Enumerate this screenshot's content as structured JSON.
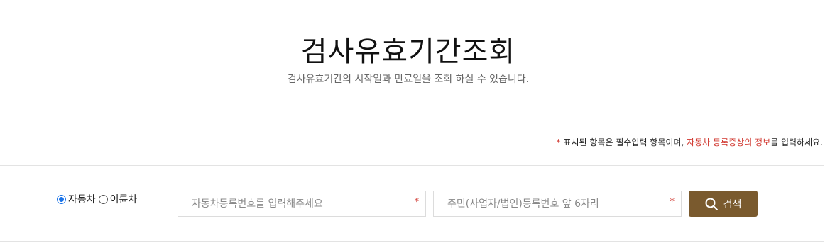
{
  "page": {
    "title": "검사유효기간조회",
    "subtitle": "검사유효기간의 시작일과 만료일을 조회 하실 수 있습니다."
  },
  "notice": {
    "asterisk": "*",
    "text_before": " 표시된 항목은 필수입력 항목이며, ",
    "highlight": "자동차 등록증상의 정보",
    "text_after": "를 입력하세요."
  },
  "vehicle_type": {
    "options": [
      {
        "label": "자동차",
        "checked": true
      },
      {
        "label": "이륜차",
        "checked": false
      }
    ]
  },
  "form": {
    "reg_number": {
      "value": "",
      "placeholder": "자동차등록번호를 입력해주세요",
      "required_mark": "*"
    },
    "id_number": {
      "value": "",
      "placeholder": "주민(사업자/법인)등록번호 앞 6자리",
      "required_mark": "*"
    },
    "search_label": "검색",
    "search_icon": "search-icon",
    "accent_color": "#7a5a2e",
    "required_color": "#d0342c"
  }
}
